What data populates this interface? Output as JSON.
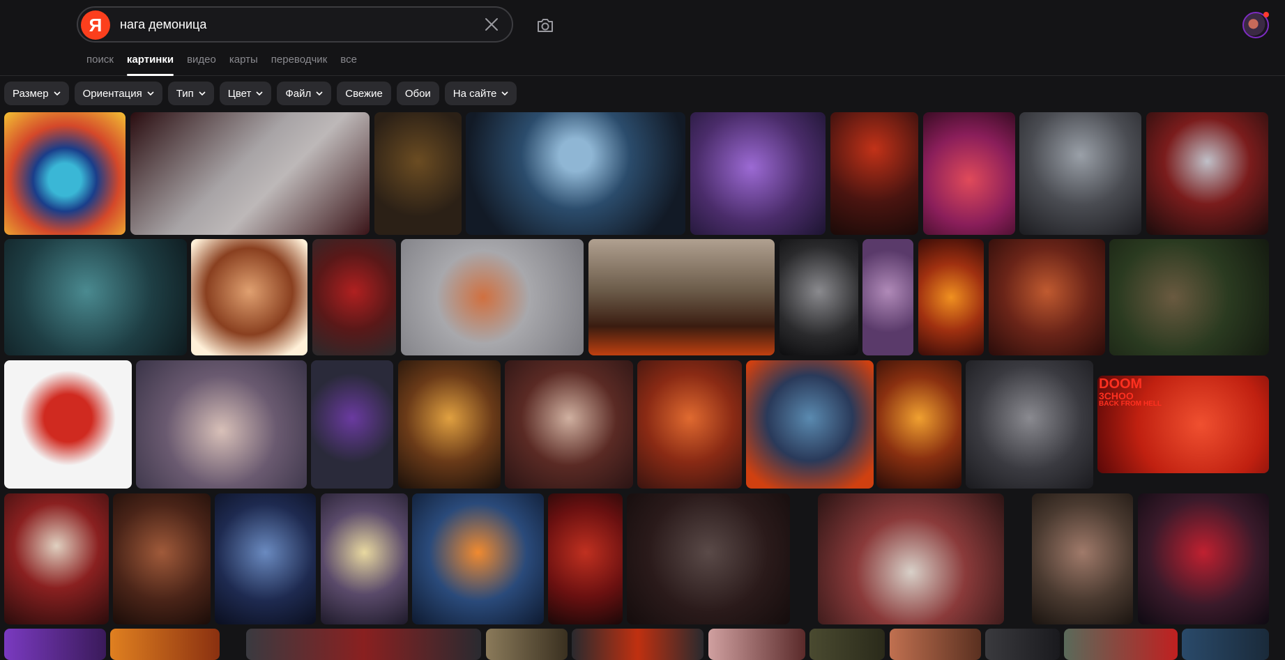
{
  "search": {
    "query": "нага демоница",
    "logo_letter": "Я",
    "brand_color": "#fc3f1d"
  },
  "icons": [
    "yandex-logo-icon",
    "clear-icon",
    "camera-icon",
    "chevron-down-icon",
    "avatar"
  ],
  "tabs": [
    {
      "label": "поиск",
      "active": false
    },
    {
      "label": "картинки",
      "active": true
    },
    {
      "label": "видео",
      "active": false
    },
    {
      "label": "карты",
      "active": false
    },
    {
      "label": "переводчик",
      "active": false
    },
    {
      "label": "все",
      "active": false
    }
  ],
  "filters": [
    {
      "label": "Размер",
      "dropdown": true
    },
    {
      "label": "Ориентация",
      "dropdown": true
    },
    {
      "label": "Тип",
      "dropdown": true
    },
    {
      "label": "Цвет",
      "dropdown": true
    },
    {
      "label": "Файл",
      "dropdown": true
    },
    {
      "label": "Свежие",
      "dropdown": false
    },
    {
      "label": "Обои",
      "dropdown": false
    },
    {
      "label": "На сайте",
      "dropdown": true
    }
  ],
  "thumbnail_text": {
    "line1": "DOOM",
    "line2": "3CHOO",
    "line3": "BACK FROM HELL"
  }
}
